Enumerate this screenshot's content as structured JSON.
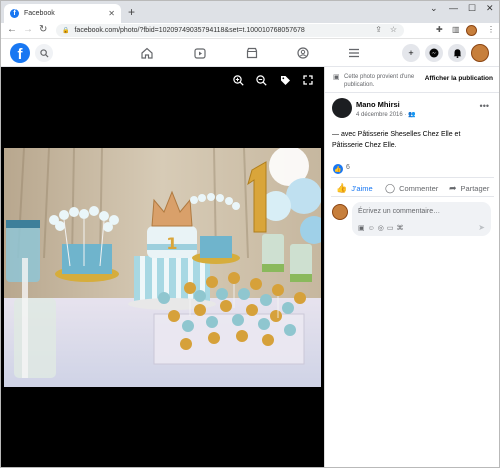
{
  "browser": {
    "tab_title": "Facebook",
    "tab_favicon": "f",
    "tab_close": "✕",
    "new_tab": "+",
    "url": "facebook.com/photo/?fbid=10209749035794118&set=t.100010768057678",
    "win_min": "—",
    "win_max": "☐",
    "win_close": "✕",
    "win_chevron": "⌄"
  },
  "facebook": {
    "logo": "f",
    "search_icon": "search-icon",
    "nav_icons": [
      "home-icon",
      "watch-icon",
      "marketplace-icon",
      "groups-icon",
      "menu-icon"
    ]
  },
  "viewer": {
    "controls": [
      "zoom-in-icon",
      "zoom-out-icon",
      "tag-icon",
      "fullscreen-icon"
    ]
  },
  "panel": {
    "notice": "Cette photo provient d'une publication.",
    "show_publication": "Afficher la publication",
    "author": "Mano Mhirsi",
    "date": "4 décembre 2016 · ",
    "post_text": "— avec Pâtisserie Sheselles Chez Elle et Pâtisserie Chez Elle.",
    "like_count": "6",
    "actions": {
      "like": "J'aime",
      "comment": "Commenter",
      "share": "Partager"
    },
    "comment_placeholder": "Écrivez un commentaire…"
  },
  "colors": {
    "fb_blue": "#1877f2",
    "viewer_bg": "#000000",
    "muted_text": "#65676b"
  }
}
